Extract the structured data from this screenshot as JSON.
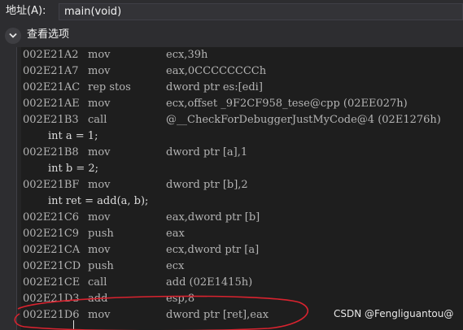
{
  "address_bar": {
    "label": "地址(A):",
    "value": "main(void)"
  },
  "view_options": {
    "label": "查看选项",
    "icon": "chevron-down-icon"
  },
  "lines": [
    {
      "type": "asm",
      "address": "002E21A2",
      "mnemonic": "mov",
      "operands": "ecx,39h"
    },
    {
      "type": "asm",
      "address": "002E21A7",
      "mnemonic": "mov",
      "operands": "eax,0CCCCCCCCh"
    },
    {
      "type": "asm",
      "address": "002E21AC",
      "mnemonic": "rep stos",
      "operands": "dword ptr es:[edi]"
    },
    {
      "type": "asm",
      "address": "002E21AE",
      "mnemonic": "mov",
      "operands": "ecx,offset _9F2CF958_tese@cpp (02EE027h)"
    },
    {
      "type": "asm",
      "address": "002E21B3",
      "mnemonic": "call",
      "operands": "@__CheckForDebuggerJustMyCode@4 (02E1276h)"
    },
    {
      "type": "src",
      "text": "int a = 1;"
    },
    {
      "type": "asm",
      "address": "002E21B8",
      "mnemonic": "mov",
      "operands": "dword ptr [a],1"
    },
    {
      "type": "src",
      "text": "int b = 2;"
    },
    {
      "type": "asm",
      "address": "002E21BF",
      "mnemonic": "mov",
      "operands": "dword ptr [b],2"
    },
    {
      "type": "src",
      "text": "int ret = add(a, b);"
    },
    {
      "type": "asm",
      "address": "002E21C6",
      "mnemonic": "mov",
      "operands": "eax,dword ptr [b]"
    },
    {
      "type": "asm",
      "address": "002E21C9",
      "mnemonic": "push",
      "operands": "eax"
    },
    {
      "type": "asm",
      "address": "002E21CA",
      "mnemonic": "mov",
      "operands": "ecx,dword ptr [a]"
    },
    {
      "type": "asm",
      "address": "002E21CD",
      "mnemonic": "push",
      "operands": "ecx"
    },
    {
      "type": "asm",
      "address": "002E21CE",
      "mnemonic": "call",
      "operands": "add (02E1415h)"
    },
    {
      "type": "asm",
      "address": "002E21D3",
      "mnemonic": "add",
      "operands": "esp,8"
    },
    {
      "type": "asm",
      "address": "002E21D6",
      "mnemonic": "mov",
      "operands": "dword ptr [ret],eax"
    }
  ],
  "watermark": "CSDN @Fengliguantou@",
  "colors": {
    "background": "#1e1e1e",
    "chrome": "#2d2d30",
    "asm_text": "#b4b4b4",
    "source_text": "#dcdcdc",
    "annotation": "#d9232f"
  }
}
